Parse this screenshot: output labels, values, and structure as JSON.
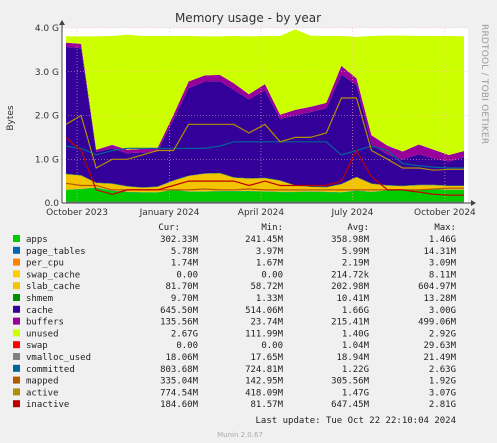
{
  "chart_data": {
    "type": "area",
    "title": "Memory usage - by year",
    "ylabel": "Bytes",
    "vendor_label": "RRDTOOL / TOBI OETIKER",
    "ylim": [
      0,
      4.0
    ],
    "y_unit": "G",
    "y_ticks": [
      "0.0",
      "1.0 G",
      "2.0 G",
      "3.0 G",
      "4.0 G"
    ],
    "y_tick_values": [
      0,
      1,
      2,
      3,
      4
    ],
    "x_ticks": [
      "October 2023",
      "January 2024",
      "April 2024",
      "July 2024",
      "October 2024"
    ],
    "x_tick_dates": [
      "2023-10-01",
      "2024-01-01",
      "2024-04-01",
      "2024-07-01",
      "2024-10-01"
    ],
    "x_start": "2023-09-16",
    "x_end": "2024-10-24",
    "grid": true,
    "legend_placement": "bottom",
    "stack_order": [
      "apps",
      "page_tables",
      "per_cpu",
      "swap_cache",
      "slab_cache",
      "shmem",
      "cache",
      "buffers",
      "unused",
      "swap"
    ],
    "line_series": [
      "vmalloc_used",
      "committed",
      "mapped",
      "active",
      "inactive"
    ],
    "dates": [
      "2023-09-20",
      "2023-10-05",
      "2023-10-20",
      "2023-11-05",
      "2023-11-20",
      "2023-12-05",
      "2023-12-20",
      "2024-01-05",
      "2024-01-20",
      "2024-02-05",
      "2024-02-20",
      "2024-03-05",
      "2024-03-20",
      "2024-04-05",
      "2024-04-20",
      "2024-05-05",
      "2024-05-20",
      "2024-06-05",
      "2024-06-20",
      "2024-07-05",
      "2024-07-20",
      "2024-08-05",
      "2024-08-20",
      "2024-09-05",
      "2024-09-20",
      "2024-10-05",
      "2024-10-20"
    ],
    "stack_values": {
      "apps": [
        0.3,
        0.32,
        0.35,
        0.28,
        0.25,
        0.24,
        0.24,
        0.3,
        0.26,
        0.26,
        0.27,
        0.27,
        0.27,
        0.26,
        0.25,
        0.25,
        0.26,
        0.25,
        0.24,
        0.28,
        0.25,
        0.29,
        0.3,
        0.3,
        0.31,
        0.3,
        0.3
      ],
      "page_tables": [
        0.005,
        0.005,
        0.005,
        0.005,
        0.005,
        0.005,
        0.005,
        0.005,
        0.005,
        0.005,
        0.005,
        0.005,
        0.005,
        0.005,
        0.005,
        0.005,
        0.005,
        0.005,
        0.005,
        0.005,
        0.005,
        0.005,
        0.005,
        0.005,
        0.005,
        0.006,
        0.006
      ],
      "per_cpu": [
        0.002,
        0.002,
        0.002,
        0.002,
        0.002,
        0.002,
        0.002,
        0.002,
        0.002,
        0.002,
        0.002,
        0.002,
        0.002,
        0.002,
        0.002,
        0.002,
        0.002,
        0.002,
        0.002,
        0.002,
        0.002,
        0.002,
        0.002,
        0.002,
        0.002,
        0.002,
        0.002
      ],
      "swap_cache": [
        0,
        0,
        0,
        0,
        0,
        0,
        0,
        0,
        0,
        0,
        0,
        0,
        0,
        0,
        0,
        0,
        0,
        0,
        0,
        0,
        0,
        0,
        0,
        0,
        0,
        0,
        0
      ],
      "slab_cache": [
        0.35,
        0.3,
        0.1,
        0.15,
        0.12,
        0.1,
        0.12,
        0.2,
        0.35,
        0.4,
        0.4,
        0.3,
        0.28,
        0.3,
        0.25,
        0.14,
        0.1,
        0.1,
        0.18,
        0.3,
        0.18,
        0.1,
        0.08,
        0.1,
        0.09,
        0.08,
        0.08
      ],
      "shmem": [
        0.01,
        0.01,
        0.01,
        0.01,
        0.01,
        0.01,
        0.01,
        0.01,
        0.01,
        0.01,
        0.01,
        0.01,
        0.01,
        0.01,
        0.01,
        0.01,
        0.01,
        0.01,
        0.01,
        0.01,
        0.01,
        0.01,
        0.01,
        0.01,
        0.01,
        0.01,
        0.01
      ],
      "cache": [
        2.9,
        2.9,
        0.7,
        0.8,
        0.75,
        0.8,
        0.8,
        1.4,
        2.0,
        2.1,
        2.1,
        2.0,
        1.8,
        2.0,
        1.4,
        1.6,
        1.7,
        1.8,
        2.5,
        2.1,
        0.9,
        0.7,
        0.6,
        0.7,
        0.6,
        0.55,
        0.65
      ],
      "buffers": [
        0.1,
        0.1,
        0.05,
        0.08,
        0.08,
        0.08,
        0.08,
        0.1,
        0.15,
        0.14,
        0.14,
        0.15,
        0.12,
        0.14,
        0.1,
        0.12,
        0.12,
        0.12,
        0.2,
        0.15,
        0.2,
        0.2,
        0.18,
        0.22,
        0.2,
        0.15,
        0.14
      ],
      "unused": [
        0.14,
        0.17,
        2.59,
        2.49,
        2.63,
        2.58,
        2.56,
        1.8,
        1.04,
        0.89,
        0.88,
        1.08,
        1.32,
        1.1,
        1.8,
        1.84,
        1.63,
        1.53,
        0.68,
        0.95,
        2.27,
        2.52,
        2.65,
        2.48,
        2.6,
        2.72,
        2.62
      ],
      "swap": [
        0,
        0,
        0,
        0,
        0,
        0,
        0,
        0,
        0,
        0,
        0,
        0,
        0,
        0,
        0,
        0,
        0,
        0,
        0,
        0,
        0,
        0,
        0,
        0,
        0,
        0,
        0
      ]
    },
    "line_values": {
      "vmalloc_used": [
        0.019,
        0.019,
        0.019,
        0.019,
        0.019,
        0.019,
        0.019,
        0.019,
        0.019,
        0.019,
        0.019,
        0.019,
        0.019,
        0.019,
        0.019,
        0.019,
        0.019,
        0.019,
        0.019,
        0.019,
        0.019,
        0.019,
        0.019,
        0.019,
        0.019,
        0.018,
        0.018
      ],
      "committed": [
        1.3,
        1.25,
        1.1,
        1.2,
        1.25,
        1.25,
        1.25,
        1.25,
        1.25,
        1.25,
        1.3,
        1.4,
        1.4,
        1.4,
        1.4,
        1.4,
        1.4,
        1.4,
        1.1,
        1.2,
        1.3,
        1.2,
        0.9,
        0.85,
        0.82,
        0.8,
        0.8
      ],
      "mapped": [
        0.45,
        0.4,
        0.4,
        0.3,
        0.3,
        0.3,
        0.3,
        0.3,
        0.3,
        0.32,
        0.3,
        0.3,
        0.32,
        0.3,
        0.3,
        0.3,
        0.3,
        0.3,
        0.3,
        0.3,
        0.3,
        0.3,
        0.3,
        0.3,
        0.32,
        0.34,
        0.34
      ],
      "active": [
        1.8,
        2.0,
        0.8,
        1.0,
        1.0,
        1.1,
        1.2,
        1.2,
        1.8,
        1.8,
        1.8,
        1.8,
        1.6,
        1.8,
        1.4,
        1.5,
        1.5,
        1.6,
        2.4,
        2.4,
        1.2,
        1.0,
        0.8,
        0.8,
        0.75,
        0.77,
        0.77
      ],
      "inactive": [
        1.5,
        1.2,
        0.3,
        0.2,
        0.3,
        0.3,
        0.3,
        0.4,
        0.5,
        0.5,
        0.5,
        0.5,
        0.4,
        0.5,
        0.4,
        0.4,
        0.4,
        0.4,
        0.5,
        1.2,
        0.6,
        0.3,
        0.3,
        0.25,
        0.2,
        0.18,
        0.18
      ]
    },
    "series": [
      {
        "name": "apps",
        "color": "#00cc00",
        "cur": "302.33M",
        "min": "241.45M",
        "avg": "358.98M",
        "max": "1.46G"
      },
      {
        "name": "page_tables",
        "color": "#0066b3",
        "cur": "5.78M",
        "min": "3.97M",
        "avg": "5.99M",
        "max": "14.31M"
      },
      {
        "name": "per_cpu",
        "color": "#ff8000",
        "cur": "1.74M",
        "min": "1.67M",
        "avg": "2.19M",
        "max": "3.09M"
      },
      {
        "name": "swap_cache",
        "color": "#ffcc00",
        "cur": "0.00",
        "min": "0.00",
        "avg": "214.72k",
        "max": "8.11M"
      },
      {
        "name": "slab_cache",
        "color": "#f3c400",
        "cur": "81.70M",
        "min": "58.72M",
        "avg": "202.98M",
        "max": "604.97M"
      },
      {
        "name": "shmem",
        "color": "#008f00",
        "cur": "9.70M",
        "min": "1.33M",
        "avg": "10.41M",
        "max": "13.28M"
      },
      {
        "name": "cache",
        "color": "#330099",
        "cur": "645.50M",
        "min": "514.06M",
        "avg": "1.66G",
        "max": "3.00G"
      },
      {
        "name": "buffers",
        "color": "#990099",
        "cur": "135.56M",
        "min": "23.74M",
        "avg": "215.41M",
        "max": "499.06M"
      },
      {
        "name": "unused",
        "color": "#ccff00",
        "cur": "2.67G",
        "min": "111.99M",
        "avg": "1.40G",
        "max": "2.92G"
      },
      {
        "name": "swap",
        "color": "#ff0000",
        "cur": "0.00",
        "min": "0.00",
        "avg": "1.04M",
        "max": "29.63M"
      },
      {
        "name": "vmalloc_used",
        "color": "#808080",
        "cur": "18.06M",
        "min": "17.65M",
        "avg": "18.94M",
        "max": "21.49M"
      },
      {
        "name": "committed",
        "color": "#006699",
        "cur": "803.68M",
        "min": "724.81M",
        "avg": "1.22G",
        "max": "2.63G"
      },
      {
        "name": "mapped",
        "color": "#b35a00",
        "cur": "335.04M",
        "min": "142.95M",
        "avg": "305.56M",
        "max": "1.92G"
      },
      {
        "name": "active",
        "color": "#b38f00",
        "cur": "774.54M",
        "min": "418.09M",
        "avg": "1.47G",
        "max": "3.07G"
      },
      {
        "name": "inactive",
        "color": "#bb0000",
        "cur": "184.60M",
        "min": "81.57M",
        "avg": "647.45M",
        "max": "2.81G"
      }
    ]
  },
  "legend_header": {
    "cur": "Cur:",
    "min": "Min:",
    "avg": "Avg:",
    "max": "Max:"
  },
  "last_update": "Last update: Tue Oct 22 22:10:04 2024",
  "footer": "Munin 2.0.67",
  "colors": {
    "background": "#f0f0f0",
    "plot_background": "#ffffff",
    "grid": "#ffb0b0",
    "axis": "#444444"
  }
}
